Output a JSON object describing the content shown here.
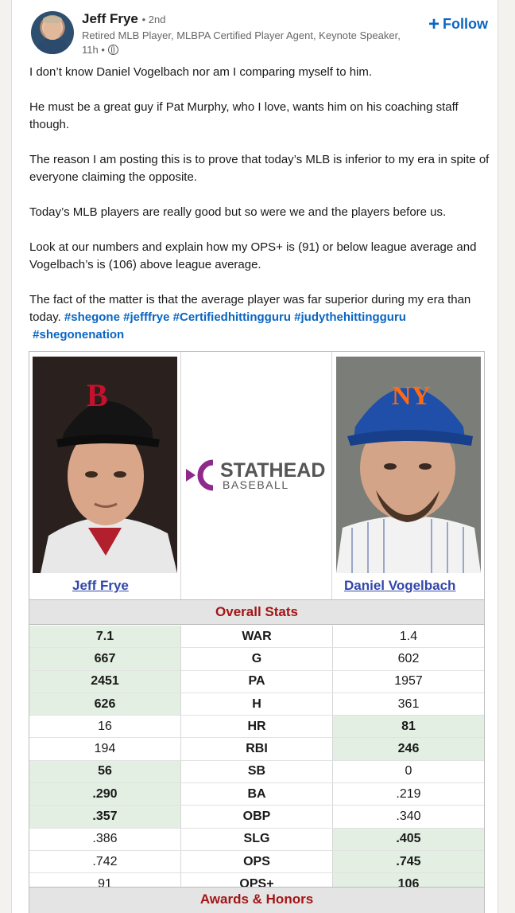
{
  "author": {
    "name": "Jeff Frye",
    "degree": "• 2nd",
    "headline": "Retired MLB Player, MLBPA Certified Player Agent, Keynote Speaker,",
    "time": "11h •"
  },
  "follow_label": "Follow",
  "post": {
    "paragraphs": [
      "I don’t know Daniel Vogelbach nor am I comparing myself to him.",
      "He must be a great guy if Pat Murphy, who I love, wants him on his coaching staff though.",
      "The reason I am posting this is to prove that today’s MLB is inferior to my era in spite of everyone claiming the opposite.",
      "Today’s MLB players are really good but so were we and the players before us.",
      "Look at our numbers and explain how my OPS+ is (91) or below league average and Vogelbach’s is (106) above league average.",
      "The fact of the matter is that the average player was far superior during my era than today."
    ],
    "hashtags": [
      "#shegone",
      "#jefffrye",
      "#Certifiedhittingguru",
      "#judythehittingguru",
      "#shegonenation"
    ]
  },
  "comparison": {
    "logo_top": "STATHEAD",
    "logo_bottom": "BASEBALL",
    "player_left": "Jeff Frye",
    "player_right": "Daniel Vogelbach",
    "section_overall": "Overall Stats",
    "section_awards": "Awards & Honors",
    "rows": [
      {
        "stat": "WAR",
        "left": "7.1",
        "right": "1.4",
        "winner": "left"
      },
      {
        "stat": "G",
        "left": "667",
        "right": "602",
        "winner": "left"
      },
      {
        "stat": "PA",
        "left": "2451",
        "right": "1957",
        "winner": "left"
      },
      {
        "stat": "H",
        "left": "626",
        "right": "361",
        "winner": "left"
      },
      {
        "stat": "HR",
        "left": "16",
        "right": "81",
        "winner": "right"
      },
      {
        "stat": "RBI",
        "left": "194",
        "right": "246",
        "winner": "right"
      },
      {
        "stat": "SB",
        "left": "56",
        "right": "0",
        "winner": "left"
      },
      {
        "stat": "BA",
        "left": ".290",
        "right": ".219",
        "winner": "left"
      },
      {
        "stat": "OBP",
        "left": ".357",
        "right": ".340",
        "winner": "left"
      },
      {
        "stat": "SLG",
        "left": ".386",
        "right": ".405",
        "winner": "right"
      },
      {
        "stat": "OPS",
        "left": ".742",
        "right": ".745",
        "winner": "right"
      },
      {
        "stat": "OPS+",
        "left": "91",
        "right": "106",
        "winner": "right"
      }
    ]
  },
  "colors": {
    "accent": "#0a66c2",
    "player_link": "#3347ab",
    "section_title": "#a31515",
    "highlight": "#e3efe3",
    "logo_purple": "#8e2a8b"
  }
}
